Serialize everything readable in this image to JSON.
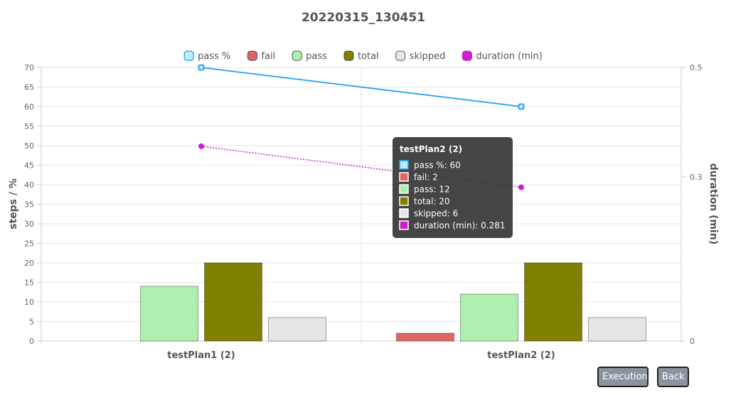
{
  "chart_data": {
    "type": "bar",
    "title": "20220315_130451",
    "categories": [
      "testPlan1 (2)",
      "testPlan2 (2)"
    ],
    "series": [
      {
        "name": "pass %",
        "kind": "line",
        "axis": "left",
        "color": "#1ea0f0",
        "fill": "#bfeaff",
        "values": [
          70,
          60
        ]
      },
      {
        "name": "fail",
        "kind": "bar",
        "axis": "left",
        "color": "#e06666",
        "values": [
          0,
          2
        ]
      },
      {
        "name": "pass",
        "kind": "bar",
        "axis": "left",
        "color": "#b0eeb0",
        "values": [
          14,
          12
        ]
      },
      {
        "name": "total",
        "kind": "bar",
        "axis": "left",
        "color": "#808000",
        "values": [
          20,
          20
        ]
      },
      {
        "name": "skipped",
        "kind": "bar",
        "axis": "left",
        "color": "#e6e6e6",
        "values": [
          6,
          6
        ]
      },
      {
        "name": "duration (min)",
        "kind": "line-dotted",
        "axis": "right",
        "color": "#cc22cc",
        "values": [
          0.356,
          0.281
        ]
      }
    ],
    "yleft": {
      "label": "steps / %",
      "min": 0,
      "max": 70,
      "ticks": [
        0,
        5,
        10,
        15,
        20,
        25,
        30,
        35,
        40,
        45,
        50,
        55,
        60,
        65,
        70
      ]
    },
    "yright": {
      "label": "duration (min)",
      "min": 0,
      "max": 0.5,
      "ticks": [
        0,
        0.3,
        0.5
      ]
    },
    "legend": "top",
    "grid": true,
    "tooltip": {
      "category_index": 1,
      "title": "testPlan2 (2)",
      "lines": [
        {
          "text": "pass %: 60",
          "series": "pass %"
        },
        {
          "text": "fail: 2",
          "series": "fail"
        },
        {
          "text": "pass: 12",
          "series": "pass"
        },
        {
          "text": "total: 20",
          "series": "total"
        },
        {
          "text": "skipped: 6",
          "series": "skipped"
        },
        {
          "text": "duration (min): 0.281",
          "series": "duration (min)"
        }
      ]
    }
  },
  "buttons": {
    "execution": "Execution",
    "back": "Back"
  }
}
